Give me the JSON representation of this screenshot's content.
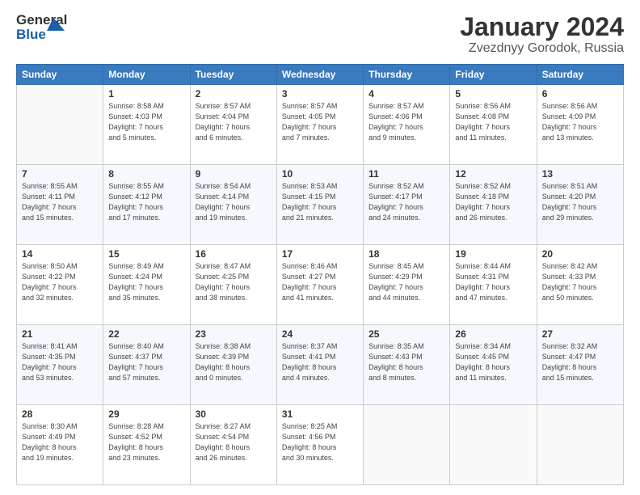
{
  "header": {
    "logo_line1": "General",
    "logo_line2": "Blue",
    "month": "January 2024",
    "location": "Zvezdnyy Gorodok, Russia"
  },
  "days_of_week": [
    "Sunday",
    "Monday",
    "Tuesday",
    "Wednesday",
    "Thursday",
    "Friday",
    "Saturday"
  ],
  "weeks": [
    [
      {
        "num": "",
        "info": ""
      },
      {
        "num": "1",
        "info": "Sunrise: 8:58 AM\nSunset: 4:03 PM\nDaylight: 7 hours\nand 5 minutes."
      },
      {
        "num": "2",
        "info": "Sunrise: 8:57 AM\nSunset: 4:04 PM\nDaylight: 7 hours\nand 6 minutes."
      },
      {
        "num": "3",
        "info": "Sunrise: 8:57 AM\nSunset: 4:05 PM\nDaylight: 7 hours\nand 7 minutes."
      },
      {
        "num": "4",
        "info": "Sunrise: 8:57 AM\nSunset: 4:06 PM\nDaylight: 7 hours\nand 9 minutes."
      },
      {
        "num": "5",
        "info": "Sunrise: 8:56 AM\nSunset: 4:08 PM\nDaylight: 7 hours\nand 11 minutes."
      },
      {
        "num": "6",
        "info": "Sunrise: 8:56 AM\nSunset: 4:09 PM\nDaylight: 7 hours\nand 13 minutes."
      }
    ],
    [
      {
        "num": "7",
        "info": "Sunrise: 8:55 AM\nSunset: 4:11 PM\nDaylight: 7 hours\nand 15 minutes."
      },
      {
        "num": "8",
        "info": "Sunrise: 8:55 AM\nSunset: 4:12 PM\nDaylight: 7 hours\nand 17 minutes."
      },
      {
        "num": "9",
        "info": "Sunrise: 8:54 AM\nSunset: 4:14 PM\nDaylight: 7 hours\nand 19 minutes."
      },
      {
        "num": "10",
        "info": "Sunrise: 8:53 AM\nSunset: 4:15 PM\nDaylight: 7 hours\nand 21 minutes."
      },
      {
        "num": "11",
        "info": "Sunrise: 8:52 AM\nSunset: 4:17 PM\nDaylight: 7 hours\nand 24 minutes."
      },
      {
        "num": "12",
        "info": "Sunrise: 8:52 AM\nSunset: 4:18 PM\nDaylight: 7 hours\nand 26 minutes."
      },
      {
        "num": "13",
        "info": "Sunrise: 8:51 AM\nSunset: 4:20 PM\nDaylight: 7 hours\nand 29 minutes."
      }
    ],
    [
      {
        "num": "14",
        "info": "Sunrise: 8:50 AM\nSunset: 4:22 PM\nDaylight: 7 hours\nand 32 minutes."
      },
      {
        "num": "15",
        "info": "Sunrise: 8:49 AM\nSunset: 4:24 PM\nDaylight: 7 hours\nand 35 minutes."
      },
      {
        "num": "16",
        "info": "Sunrise: 8:47 AM\nSunset: 4:25 PM\nDaylight: 7 hours\nand 38 minutes."
      },
      {
        "num": "17",
        "info": "Sunrise: 8:46 AM\nSunset: 4:27 PM\nDaylight: 7 hours\nand 41 minutes."
      },
      {
        "num": "18",
        "info": "Sunrise: 8:45 AM\nSunset: 4:29 PM\nDaylight: 7 hours\nand 44 minutes."
      },
      {
        "num": "19",
        "info": "Sunrise: 8:44 AM\nSunset: 4:31 PM\nDaylight: 7 hours\nand 47 minutes."
      },
      {
        "num": "20",
        "info": "Sunrise: 8:42 AM\nSunset: 4:33 PM\nDaylight: 7 hours\nand 50 minutes."
      }
    ],
    [
      {
        "num": "21",
        "info": "Sunrise: 8:41 AM\nSunset: 4:35 PM\nDaylight: 7 hours\nand 53 minutes."
      },
      {
        "num": "22",
        "info": "Sunrise: 8:40 AM\nSunset: 4:37 PM\nDaylight: 7 hours\nand 57 minutes."
      },
      {
        "num": "23",
        "info": "Sunrise: 8:38 AM\nSunset: 4:39 PM\nDaylight: 8 hours\nand 0 minutes."
      },
      {
        "num": "24",
        "info": "Sunrise: 8:37 AM\nSunset: 4:41 PM\nDaylight: 8 hours\nand 4 minutes."
      },
      {
        "num": "25",
        "info": "Sunrise: 8:35 AM\nSunset: 4:43 PM\nDaylight: 8 hours\nand 8 minutes."
      },
      {
        "num": "26",
        "info": "Sunrise: 8:34 AM\nSunset: 4:45 PM\nDaylight: 8 hours\nand 11 minutes."
      },
      {
        "num": "27",
        "info": "Sunrise: 8:32 AM\nSunset: 4:47 PM\nDaylight: 8 hours\nand 15 minutes."
      }
    ],
    [
      {
        "num": "28",
        "info": "Sunrise: 8:30 AM\nSunset: 4:49 PM\nDaylight: 8 hours\nand 19 minutes."
      },
      {
        "num": "29",
        "info": "Sunrise: 8:28 AM\nSunset: 4:52 PM\nDaylight: 8 hours\nand 23 minutes."
      },
      {
        "num": "30",
        "info": "Sunrise: 8:27 AM\nSunset: 4:54 PM\nDaylight: 8 hours\nand 26 minutes."
      },
      {
        "num": "31",
        "info": "Sunrise: 8:25 AM\nSunset: 4:56 PM\nDaylight: 8 hours\nand 30 minutes."
      },
      {
        "num": "",
        "info": ""
      },
      {
        "num": "",
        "info": ""
      },
      {
        "num": "",
        "info": ""
      }
    ]
  ]
}
